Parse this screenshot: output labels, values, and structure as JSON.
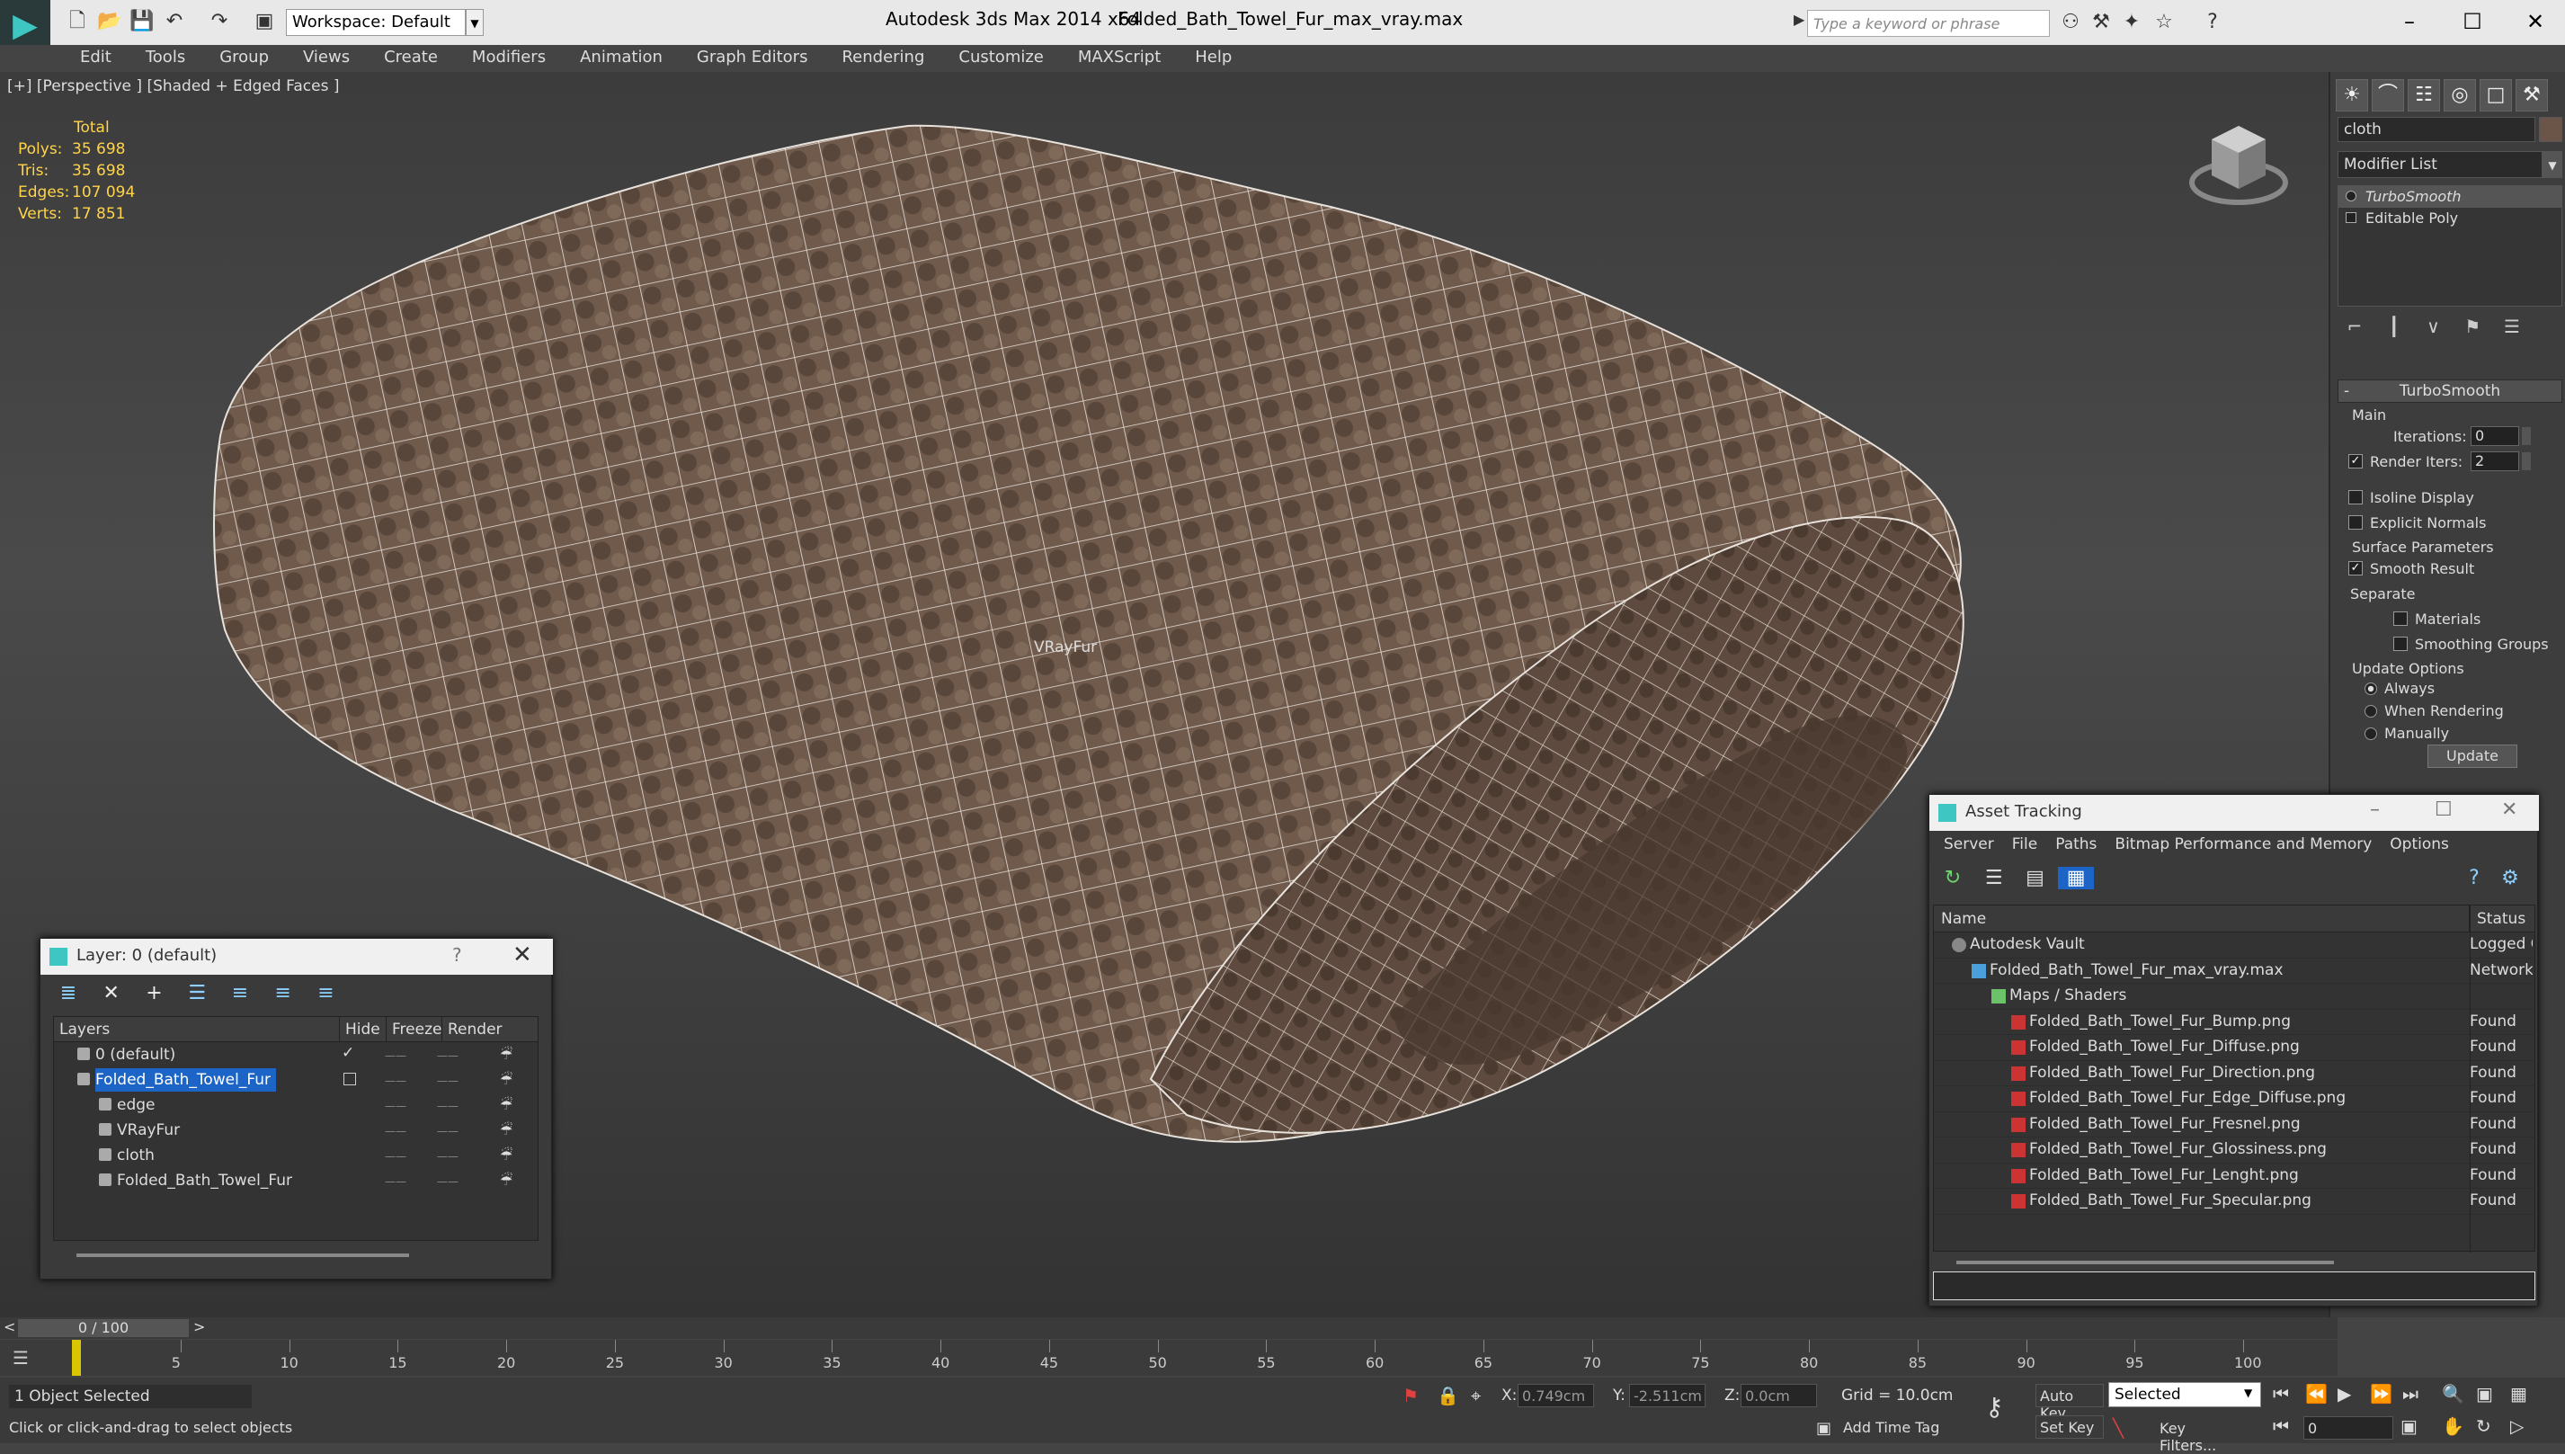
{
  "titlebar": {
    "workspace": "Workspace: Default",
    "app_title": "Autodesk 3ds Max  2014 x64",
    "file_title": "Folded_Bath_Towel_Fur_max_vray.max",
    "search_placeholder": "Type a keyword or phrase"
  },
  "menu": [
    "Edit",
    "Tools",
    "Group",
    "Views",
    "Create",
    "Modifiers",
    "Animation",
    "Graph Editors",
    "Rendering",
    "Customize",
    "MAXScript",
    "Help"
  ],
  "viewport": {
    "label": "[+] [Perspective ] [Shaded + Edged Faces ]",
    "object_label": "VRayFur",
    "stats": {
      "total_label": "Total",
      "rows": [
        {
          "label": "Polys:",
          "value": "35 698"
        },
        {
          "label": "Tris:",
          "value": "35 698"
        },
        {
          "label": "Edges:",
          "value": "107 094"
        },
        {
          "label": "Verts:",
          "value": "17 851"
        }
      ]
    }
  },
  "command_panel": {
    "object_name": "cloth",
    "modifier_list": "Modifier List",
    "stack": [
      "TurboSmooth",
      "Editable Poly"
    ],
    "turbosmooth": {
      "title": "TurboSmooth",
      "main": "Main",
      "iterations_label": "Iterations:",
      "iterations": "0",
      "render_iters_label": "Render Iters:",
      "render_iters": "2",
      "isoline": "Isoline Display",
      "explicit_normals": "Explicit Normals",
      "surface_params": "Surface Parameters",
      "smooth_result": "Smooth Result",
      "separate": "Separate",
      "materials": "Materials",
      "smoothing_groups": "Smoothing Groups",
      "update_options": "Update Options",
      "always": "Always",
      "when_rendering": "When Rendering",
      "manually": "Manually",
      "update": "Update"
    }
  },
  "layer_window": {
    "title": "Layer: 0 (default)",
    "help": "?",
    "columns": [
      "Layers",
      "Hide",
      "Freeze",
      "Render"
    ],
    "rows": [
      {
        "name": "0 (default)",
        "indent": 0,
        "check": "✓",
        "selected": false
      },
      {
        "name": "Folded_Bath_Towel_Fur",
        "indent": 0,
        "check": "",
        "selected": true
      },
      {
        "name": "edge",
        "indent": 1,
        "check": "",
        "selected": false
      },
      {
        "name": "VRayFur",
        "indent": 1,
        "check": "",
        "selected": false
      },
      {
        "name": "cloth",
        "indent": 1,
        "check": "",
        "selected": false
      },
      {
        "name": "Folded_Bath_Towel_Fur",
        "indent": 1,
        "check": "",
        "selected": false
      }
    ]
  },
  "asset_window": {
    "title": "Asset Tracking",
    "menu": [
      "Server",
      "File",
      "Paths",
      "Bitmap Performance and Memory",
      "Options"
    ],
    "columns": [
      "Name",
      "Status"
    ],
    "rows": [
      {
        "name": "Autodesk Vault",
        "status": "Logged Out",
        "indent": 1
      },
      {
        "name": "Folded_Bath_Towel_Fur_max_vray.max",
        "status": "Network",
        "indent": 2
      },
      {
        "name": "Maps / Shaders",
        "status": "",
        "indent": 3
      },
      {
        "name": "Folded_Bath_Towel_Fur_Bump.png",
        "status": "Found",
        "indent": 4
      },
      {
        "name": "Folded_Bath_Towel_Fur_Diffuse.png",
        "status": "Found",
        "indent": 4
      },
      {
        "name": "Folded_Bath_Towel_Fur_Direction.png",
        "status": "Found",
        "indent": 4
      },
      {
        "name": "Folded_Bath_Towel_Fur_Edge_Diffuse.png",
        "status": "Found",
        "indent": 4
      },
      {
        "name": "Folded_Bath_Towel_Fur_Fresnel.png",
        "status": "Found",
        "indent": 4
      },
      {
        "name": "Folded_Bath_Towel_Fur_Glossiness.png",
        "status": "Found",
        "indent": 4
      },
      {
        "name": "Folded_Bath_Towel_Fur_Lenght.png",
        "status": "Found",
        "indent": 4
      },
      {
        "name": "Folded_Bath_Towel_Fur_Specular.png",
        "status": "Found",
        "indent": 4
      }
    ]
  },
  "timeline": {
    "frame_display": "0 / 100",
    "ticks": [
      "5",
      "10",
      "15",
      "20",
      "25",
      "30",
      "35",
      "40",
      "45",
      "50",
      "55",
      "60",
      "65",
      "70",
      "75",
      "80",
      "85",
      "90",
      "95",
      "100"
    ]
  },
  "statusbar": {
    "selection": "1 Object Selected",
    "prompt": "Click or click-and-drag to select objects",
    "x_label": "X:",
    "x": "0.749cm",
    "y_label": "Y:",
    "y": "-2.511cm",
    "z_label": "Z:",
    "z": "0.0cm",
    "grid": "Grid = 10.0cm",
    "auto_key": "Auto Key",
    "selected": "Selected",
    "set_key": "Set Key",
    "key_filters": "Key Filters...",
    "add_time_tag": "Add Time Tag",
    "frame": "0"
  },
  "colors": {
    "selection": "#1c64c6",
    "stats": "#ffd44a",
    "accent": "#3ec7c2"
  }
}
